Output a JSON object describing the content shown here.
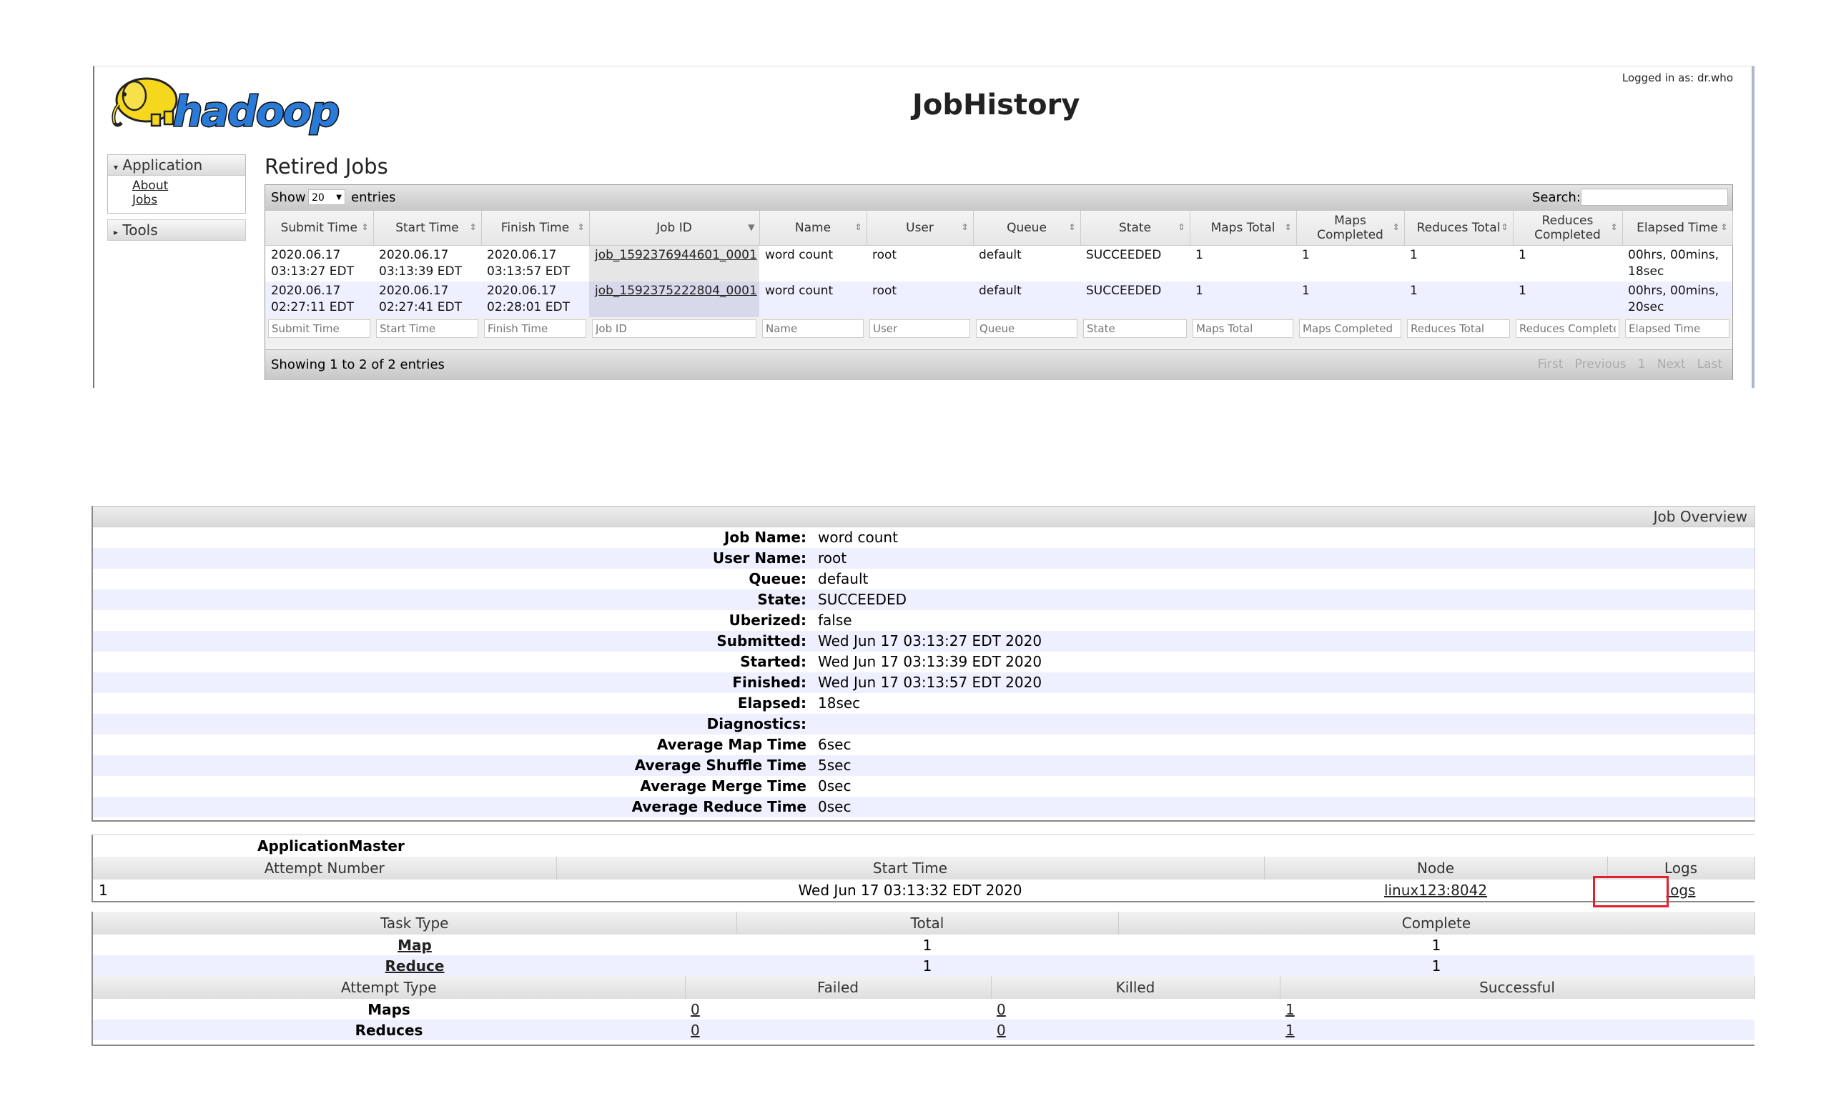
{
  "header": {
    "logo_text": "hadoop",
    "title": "JobHistory",
    "logged_in": "Logged in as: dr.who"
  },
  "nav": {
    "application": "Application",
    "about": "About",
    "jobs": "Jobs",
    "tools": "Tools"
  },
  "retired": {
    "title": "Retired Jobs",
    "show_label": "Show",
    "page_size": "20",
    "entries_label": "entries",
    "search_label": "Search:",
    "columns": [
      "Submit Time",
      "Start Time",
      "Finish Time",
      "Job ID",
      "Name",
      "User",
      "Queue",
      "State",
      "Maps Total",
      "Maps Completed",
      "Reduces Total",
      "Reduces Completed",
      "Elapsed Time"
    ],
    "rows": [
      {
        "submit": "2020.06.17 03:13:27 EDT",
        "start": "2020.06.17 03:13:39 EDT",
        "finish": "2020.06.17 03:13:57 EDT",
        "job_id": "job_1592376944601_0001",
        "name": "word count",
        "user": "root",
        "queue": "default",
        "state": "SUCCEEDED",
        "maps_total": "1",
        "maps_completed": "1",
        "reduces_total": "1",
        "reduces_completed": "1",
        "elapsed": "00hrs, 00mins, 18sec"
      },
      {
        "submit": "2020.06.17 02:27:11 EDT",
        "start": "2020.06.17 02:27:41 EDT",
        "finish": "2020.06.17 02:28:01 EDT",
        "job_id": "job_1592375222804_0001",
        "name": "word count",
        "user": "root",
        "queue": "default",
        "state": "SUCCEEDED",
        "maps_total": "1",
        "maps_completed": "1",
        "reduces_total": "1",
        "reduces_completed": "1",
        "elapsed": "00hrs, 00mins, 20sec"
      }
    ],
    "filters": [
      "Submit Time",
      "Start Time",
      "Finish Time",
      "Job ID",
      "Name",
      "User",
      "Queue",
      "State",
      "Maps Total",
      "Maps Completed",
      "Reduces Total",
      "Reduces Complete",
      "Elapsed Time"
    ],
    "info": "Showing 1 to 2 of 2 entries",
    "pager": {
      "first": "First",
      "previous": "Previous",
      "page": "1",
      "next": "Next",
      "last": "Last"
    }
  },
  "overview": {
    "title": "Job Overview",
    "rows": [
      {
        "k": "Job Name:",
        "v": "word count"
      },
      {
        "k": "User Name:",
        "v": "root"
      },
      {
        "k": "Queue:",
        "v": "default"
      },
      {
        "k": "State:",
        "v": "SUCCEEDED"
      },
      {
        "k": "Uberized:",
        "v": "false"
      },
      {
        "k": "Submitted:",
        "v": "Wed Jun 17 03:13:27 EDT 2020"
      },
      {
        "k": "Started:",
        "v": "Wed Jun 17 03:13:39 EDT 2020"
      },
      {
        "k": "Finished:",
        "v": "Wed Jun 17 03:13:57 EDT 2020"
      },
      {
        "k": "Elapsed:",
        "v": "18sec"
      },
      {
        "k": "Diagnostics:",
        "v": ""
      },
      {
        "k": "Average Map Time",
        "v": "6sec"
      },
      {
        "k": "Average Shuffle Time",
        "v": "5sec"
      },
      {
        "k": "Average Merge Time",
        "v": "0sec"
      },
      {
        "k": "Average Reduce Time",
        "v": "0sec"
      }
    ]
  },
  "am": {
    "title": "ApplicationMaster",
    "columns": [
      "Attempt Number",
      "Start Time",
      "Node",
      "Logs"
    ],
    "row": {
      "attempt": "1",
      "start": "Wed Jun 17 03:13:32 EDT 2020",
      "node": "linux123:8042",
      "logs": "logs"
    }
  },
  "tasks": {
    "columns": [
      "Task Type",
      "Total",
      "Complete"
    ],
    "rows": [
      {
        "type": "Map",
        "total": "1",
        "complete": "1"
      },
      {
        "type": "Reduce",
        "total": "1",
        "complete": "1"
      }
    ],
    "attempt_columns": [
      "Attempt Type",
      "Failed",
      "Killed",
      "Successful"
    ],
    "attempt_rows": [
      {
        "type": "Maps",
        "failed": "0",
        "killed": "0",
        "successful": "1"
      },
      {
        "type": "Reduces",
        "failed": "0",
        "killed": "0",
        "successful": "1"
      }
    ]
  },
  "colors": {
    "highlight": "#e0202a",
    "row_alt": "#eef0ff",
    "logo_yellow": "#f5d71e"
  }
}
